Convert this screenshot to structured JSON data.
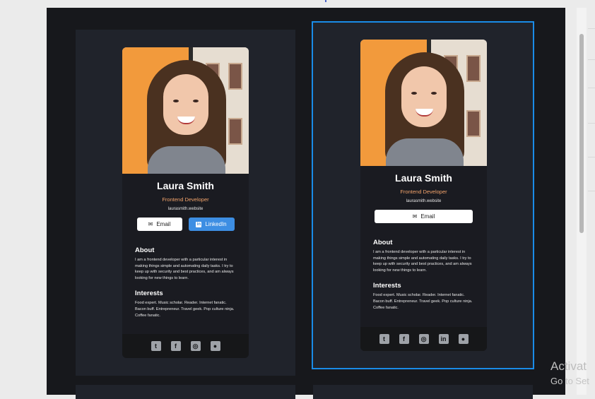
{
  "cards": [
    {
      "name": "Laura Smith",
      "role": "Frontend Developer",
      "website": "laurasmith.website",
      "email_label": "Email",
      "linkedin_label": "LinkedIn",
      "about_heading": "About",
      "about_text": "I am a frontend developer with a particular interest in making things simple and automating daily tasks. I try to keep up with security and best practices, and am always looking for new things to learn.",
      "interests_heading": "Interests",
      "interests_text": "Food expert. Music scholar. Reader. Internet fanatic. Bacon buff. Entrepreneur. Travel geek. Pop culture ninja. Coffee fanatic."
    },
    {
      "name": "Laura Smith",
      "role": "Frontend Developer",
      "website": "laurasmith.website",
      "email_label": "Email",
      "about_heading": "About",
      "about_text": "I am a frontend developer with a particular interest in making things simple and automating daily tasks. I try to keep up with security and best practices, and am always looking for new things to learn.",
      "interests_heading": "Interests",
      "interests_text": "Food expert. Music scholar. Reader. Internet fanatic. Bacon buff. Entrepreneur. Travel geek. Pop culture ninja. Coffee fanatic."
    }
  ],
  "social_icons": [
    "twitter-icon",
    "facebook-icon",
    "instagram-icon",
    "linkedin-icon",
    "github-icon"
  ],
  "watermark": {
    "line1": "Activat",
    "line2": "Go to Set"
  },
  "colors": {
    "accent_orange": "#f2a36b",
    "linkedin_blue": "#3d8ee3",
    "selection_blue": "#1a8ce8",
    "card_bg": "#1a1b21"
  }
}
